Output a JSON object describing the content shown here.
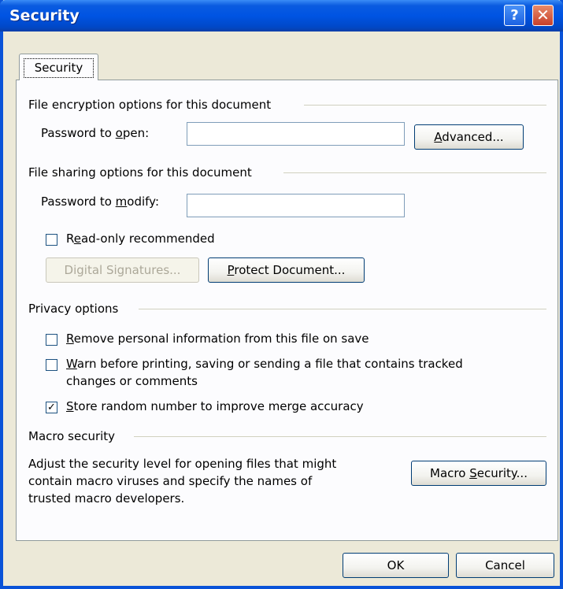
{
  "window": {
    "title": "Security"
  },
  "tabs": [
    {
      "label": "Security"
    }
  ],
  "encryption": {
    "section_title": "File encryption options for this document",
    "password_label_pre": "Password to ",
    "password_label_u": "o",
    "password_label_post": "pen:",
    "password_value": "",
    "advanced_pre": "",
    "advanced_u": "A",
    "advanced_post": "dvanced..."
  },
  "sharing": {
    "section_title": "File sharing options for this document",
    "modify_label_pre": "Password to ",
    "modify_label_u": "m",
    "modify_label_post": "odify:",
    "modify_value": "",
    "readonly_pre": "R",
    "readonly_u": "e",
    "readonly_post": "ad-only recommended",
    "readonly_checked": false,
    "digsig_label": "Digital Signatures...",
    "protect_u": "P",
    "protect_post": "rotect Document..."
  },
  "privacy": {
    "section_title": "Privacy options",
    "remove_u": "R",
    "remove_post": "emove personal information from this file on save",
    "remove_checked": false,
    "warn_u": "W",
    "warn_post": "arn before printing, saving or sending a file that contains tracked",
    "warn_line2": "changes or comments",
    "warn_checked": false,
    "store_u": "S",
    "store_post": "tore random number to improve merge accuracy",
    "store_checked": true
  },
  "macro": {
    "section_title": "Macro security",
    "desc_line1": "Adjust the security level for opening files that might",
    "desc_line2": "contain macro viruses and specify the names of",
    "desc_line3": "trusted macro developers.",
    "button_pre": "Macro ",
    "button_u": "S",
    "button_post": "ecurity..."
  },
  "footer": {
    "ok_label": "OK",
    "cancel_label": "Cancel"
  }
}
